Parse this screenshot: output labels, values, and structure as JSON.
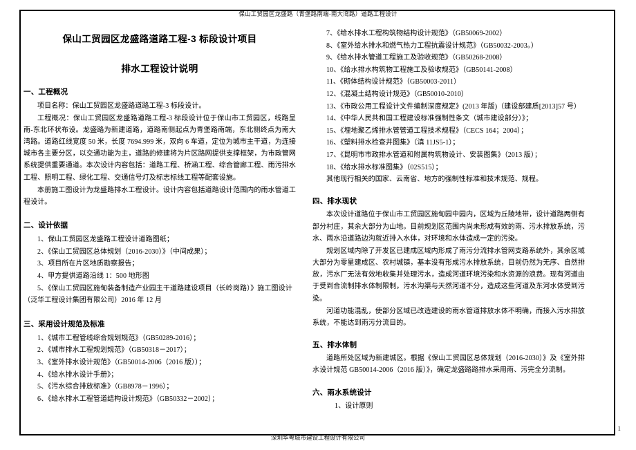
{
  "sheet": {
    "header": "保山工贸园区龙盛路（青堡路南端-南大湾路）道路工程设计",
    "footer": "深圳华粤城市建设工程设计有限公司",
    "page_number": "1"
  },
  "title": "保山工贸园区龙盛路道路工程-3 标段设计项目",
  "subtitle": "排水工程设计说明",
  "sections": {
    "overview": {
      "heading": "一、工程概况",
      "p1": "项目名称：保山工贸园区龙盛路道路工程-3 标段设计。",
      "p2": "工程概况：保山工贸园区龙盛路道路工程-3 标段设计位于保山市工贸园区，线路呈南-东北环状布设。龙盛路为新建道路，道路南侧起点为青堡路南端，东北侧终点为南大湾路。道路红线宽度 50 米，长度 7694.999 米，双向 6 车道，定位为城市主干道，为连接城市各主要分区，以交通功能为主，道路的修建将为片区路网提供支撑框架，为市政管网系统提供重要通道。本次设计内容包括：道路工程、桥涵工程、综合管廊工程、雨污排水工程、照明工程、绿化工程、交通信号灯及标志标线工程等配套设施。",
      "p3": "本册施工图设计为龙盛路排水工程设计。设计内容包括道路设计范围内的雨水管道工程设计。"
    },
    "basis": {
      "heading": "二、设计依据",
      "items": [
        "1、保山工贸园区龙盛路工程设计道路图纸；",
        "2、《保山工贸园区总体规划（2016-2030）》（中间成果）；",
        "3、项目所在片区地质勘察报告；",
        "4、甲方提供道路沿线 1：500 地形图",
        "5、《保山工贸园区施甸装备制造产业园主干道路建设项目（长岭岗路）》施工图设计（泛华工程设计集团有限公司）2016 年 12 月"
      ]
    },
    "standards": {
      "heading": "三、采用设计规范及标准",
      "items_left": [
        "1、《城市工程管线综合规划规范》（GB50289-2016）；",
        "2、《城市排水工程规划规范》（GB50318－2017）；",
        "3、《室外排水设计规范》（GB50014-2006（2016 版））；",
        "4、《给水排水设计手册》；",
        "5、《污水综合排放标准》（GB8978－1996）；",
        "6、《给水排水工程管道结构设计规范》（GB50332－2002）；"
      ],
      "items_right": [
        "7、《给水排水工程构筑物结构设计规范》（GB50069-2002）",
        "8、《室外给水排水和燃气热力工程抗震设计规范》（GB50032-2003。）",
        "9、《给水排水管道工程施工及验收规范》（GB50268-2008）",
        "10、《给水排水构筑物工程施工及验收规范》（GB50141-2008）",
        "11、《砌体结构设计规范》（GB50003-2011）",
        "12、《混凝土结构设计规范》（GB50010-2010）",
        "13、《市政公用工程设计文件编制深度规定》(2013 年版)（建设部建质[2013]57 号）",
        "14、《中华人民共和国工程建设标准强制性条文（城市建设部分）》；",
        "15、《埋地聚乙烯排水管管道工程技术规程》（CECS 164；2004）；",
        "16、《塑料排水检查井图集》（滇 11JS5-1）；",
        "17、《昆明市市政排水管道和附属构筑物设计、安装图集》（2013 版）；",
        "18、《给水排水标准图集》（02S515）；"
      ],
      "closing": "其他现行相关的国家、云南省、地方的强制性标准和技术规范、规程。"
    },
    "drainage_status": {
      "heading": "四、排水现状",
      "p1": "本次设计道路位于保山市工贸园区施甸园中园内，区域为丘陵地带，设计道路两侧有部分村庄，其余大部分为山地。目前规划区范围内尚未形成有效的雨、污水排放系统，污水、雨水沿道路边沟就近排入水体，对环境和水体造成一定的污染。",
      "p2": "规划区域内除了开发区已建成区域内形成了雨污分流排水管网支路系统外，其余区域大部分为零星建成区、农村城镇，基本没有形成污水排放系统，目前仍然为无序、自然排放，污水厂无法有效地收集并处理污水，造成河道环境污染和水资源的浪费。现有河道由于受到合流制排水体制限制，污水沟渠与天然河道不分，造成这些河道及东河水体受到污染。",
      "p3": "河道功能混乱，使部分区域已改造建设的雨水管道排放水体不明确，而接入污水排放系统，不能达到雨污分流目的。"
    },
    "drainage_system": {
      "heading": "五、排水体制",
      "p1": "道路所处区域为新建城区。根据《保山工贸园区总体规划（2016-2030）》及《室外排水设计规范 GB50014-2006（2016 版）》，确定龙盛路路排水采用雨、污完全分流制。"
    },
    "rainwater_system": {
      "heading": "六、雨水系统设计",
      "sub1": "1、设计原则"
    }
  }
}
